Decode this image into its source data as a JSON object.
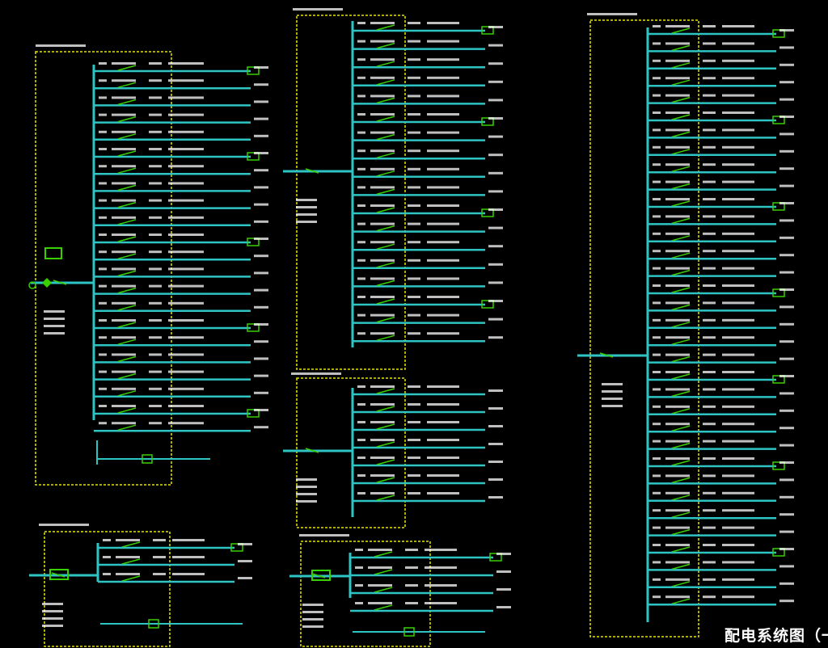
{
  "title": "配电系统图（一",
  "colors": {
    "background": "#000000",
    "bus": "#2ec4c4",
    "breaker": "#39d000",
    "box": "#e6e600",
    "text": "#ffffff"
  },
  "panels": [
    {
      "id": "panel-a",
      "circuits": 22
    },
    {
      "id": "panel-b",
      "circuits": 18
    },
    {
      "id": "panel-c",
      "circuits": 7
    },
    {
      "id": "panel-d",
      "circuits": 34
    },
    {
      "id": "panel-e",
      "circuits": 3
    },
    {
      "id": "panel-f",
      "circuits": 4
    }
  ]
}
